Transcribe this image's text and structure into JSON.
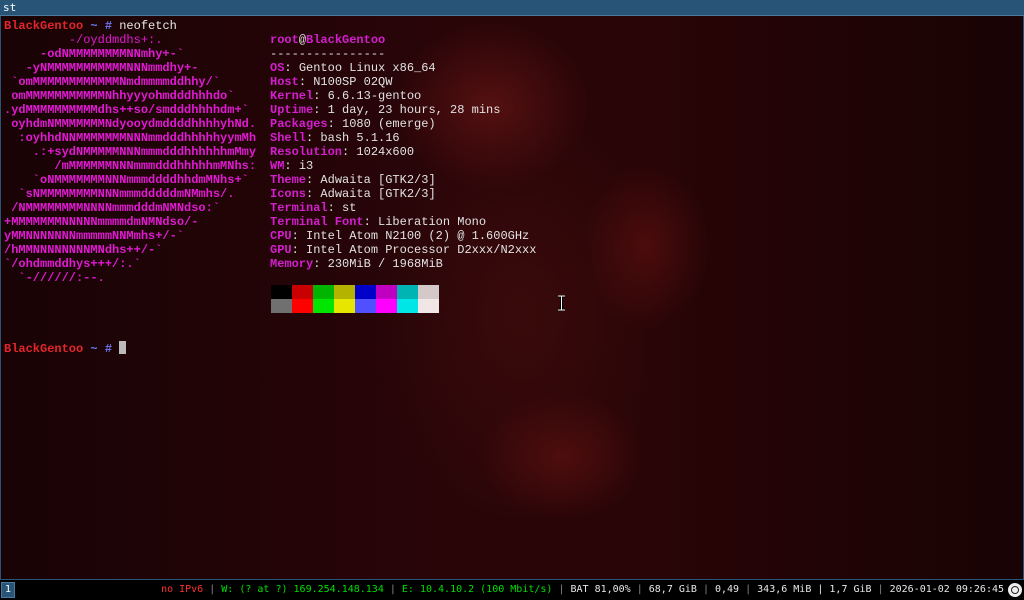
{
  "window": {
    "title": "st"
  },
  "prompt1": {
    "host": "BlackGentoo",
    "path": "~",
    "symbol": "#",
    "command": "neofetch"
  },
  "ascii": [
    "         -/oyddmdhs+:.",
    "     -odNMMMMMMMMNNmhy+-`",
    "   -yNMMMMMMMMMMMNNNmmdhy+-",
    " `omMMMMMMMMMMMMNmdmmmmddhhy/`",
    " omMMMMMMMMMMMNhhyyyohmdddhhhdo`",
    ".ydMMMMMMMMMMdhs++so/smdddhhhhdm+`",
    " oyhdmNMMMMMMMNdyooydmddddhhhhyhNd.",
    "  :oyhhdNNMMMMMMMNNNmmdddhhhhhyymMh",
    "    .:+sydNMMMMMNNNmmmdddhhhhhhmMmy",
    "       /mMMMMMMNNNmmmdddhhhhhmMNhs:",
    "    `oNMMMMMMMNNNmmmddddhhdmMNhs+`",
    "  `sNMMMMMMMMNNNmmmdddddmNMmhs/.",
    " /NMMMMMMMMNNNNmmmdddmNMNdso:`",
    "+MMMMMMMNNNNNmmmmdmNMNdso/-",
    "yMMNNNNNNNmmmmmNNMmhs+/-`",
    "/hMMNNNNNNNNMNdhs++/-`",
    "`/ohdmmddhys+++/:.`",
    "  `-//////:--."
  ],
  "user_at_host": {
    "user": "root",
    "at": "@",
    "host": "BlackGentoo"
  },
  "separator": "----------------",
  "info": [
    {
      "key": "OS",
      "value": "Gentoo Linux x86_64"
    },
    {
      "key": "Host",
      "value": "N100SP 02QW"
    },
    {
      "key": "Kernel",
      "value": "6.6.13-gentoo"
    },
    {
      "key": "Uptime",
      "value": "1 day, 23 hours, 28 mins"
    },
    {
      "key": "Packages",
      "value": "1080 (emerge)"
    },
    {
      "key": "Shell",
      "value": "bash 5.1.16"
    },
    {
      "key": "Resolution",
      "value": "1024x600"
    },
    {
      "key": "WM",
      "value": "i3"
    },
    {
      "key": "Theme",
      "value": "Adwaita [GTK2/3]"
    },
    {
      "key": "Icons",
      "value": "Adwaita [GTK2/3]"
    },
    {
      "key": "Terminal",
      "value": "st"
    },
    {
      "key": "Terminal Font",
      "value": "Liberation Mono"
    },
    {
      "key": "CPU",
      "value": "Intel Atom N2100 (2) @ 1.600GHz"
    },
    {
      "key": "GPU",
      "value": "Intel Atom Processor D2xxx/N2xxx"
    },
    {
      "key": "Memory",
      "value": "230MiB / 1968MiB"
    }
  ],
  "colors_row1": [
    "#000000",
    "#c80000",
    "#00b400",
    "#b4b400",
    "#0000c8",
    "#c000c0",
    "#00b4b4",
    "#d4c8c8"
  ],
  "colors_row2": [
    "#707070",
    "#ff0000",
    "#00e600",
    "#e6e600",
    "#5050ff",
    "#ff00ff",
    "#00e6e6",
    "#f0e6e6"
  ],
  "prompt2": {
    "host": "BlackGentoo",
    "path": "~",
    "symbol": "#"
  },
  "statusbar": {
    "workspace": "1",
    "ipv6": "no IPv6",
    "wifi": "W: (? at ?) 169.254.148.134",
    "ethernet": "E: 10.4.10.2 (100 Mbit/s)",
    "battery": "BAT 81,00%",
    "disk": "68,7 GiB",
    "load": "0,49",
    "memory": "343,6 MiB | 1,7 GiB",
    "datetime": "2026-01-02 09:26:45",
    "tray_icon": "network-tray-icon"
  }
}
